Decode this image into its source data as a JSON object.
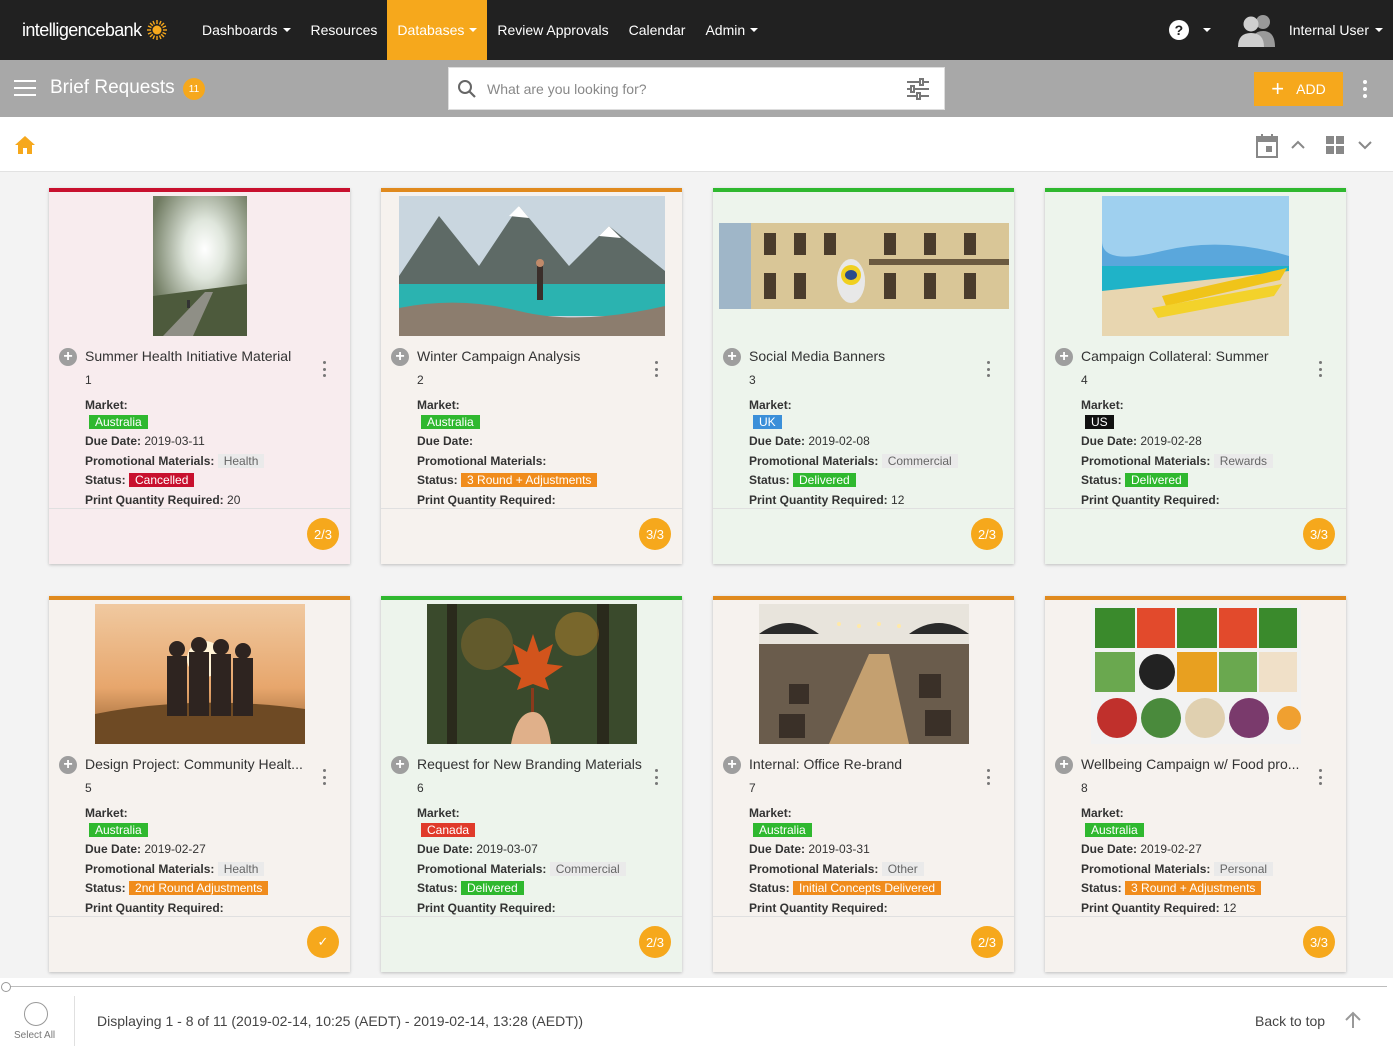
{
  "nav": {
    "logo": "intelligencebank",
    "items": [
      {
        "label": "Dashboards",
        "caret": true,
        "active": false
      },
      {
        "label": "Resources",
        "caret": false,
        "active": false
      },
      {
        "label": "Databases",
        "caret": true,
        "active": true
      },
      {
        "label": "Review Approvals",
        "caret": false,
        "active": false
      },
      {
        "label": "Calendar",
        "caret": false,
        "active": false
      },
      {
        "label": "Admin",
        "caret": true,
        "active": false
      }
    ],
    "help": "?",
    "user": "Internal User"
  },
  "toolbar": {
    "title": "Brief Requests",
    "count": "11",
    "search_placeholder": "What are you looking for?",
    "add_label": "ADD"
  },
  "cards": [
    {
      "title": "Summer Health Initiative Material",
      "id": "1",
      "bg": "#f8ecee",
      "bar": "#c8102e",
      "image": "sun-road",
      "market": "Australia",
      "market_color": "#2fb82f",
      "due": "2019-03-11",
      "promo": "Health",
      "status": "Cancelled",
      "status_color": "#c8102e",
      "print_qty": "20",
      "progress": "2/3"
    },
    {
      "title": "Winter Campaign Analysis",
      "id": "2",
      "bg": "#f6f2ee",
      "bar": "#e08a1e",
      "image": "lake",
      "market": "Australia",
      "market_color": "#2fb82f",
      "due": "",
      "promo": "",
      "status": "3 Round + Adjustments",
      "status_color": "#f08c1c",
      "print_qty": "",
      "progress": "3/3"
    },
    {
      "title": "Social Media Banners",
      "id": "3",
      "bg": "#edf4ec",
      "bar": "#2fb82f",
      "image": "building",
      "market": "UK",
      "market_color": "#3b8fd9",
      "due": "2019-02-08",
      "promo": "Commercial",
      "status": "Delivered",
      "status_color": "#2fb82f",
      "print_qty": "12",
      "progress": "2/3"
    },
    {
      "title": "Campaign Collateral: Summer",
      "id": "4",
      "bg": "#edf4ec",
      "bar": "#2fb82f",
      "image": "kayak",
      "market": "US",
      "market_color": "#111111",
      "due": "2019-02-28",
      "promo": "Rewards",
      "status": "Delivered",
      "status_color": "#2fb82f",
      "print_qty": "",
      "progress": "3/3"
    },
    {
      "title": "Design Project: Community Healt...",
      "id": "5",
      "bg": "#f6f2ee",
      "bar": "#e08a1e",
      "image": "friends",
      "market": "Australia",
      "market_color": "#2fb82f",
      "due": "2019-02-27",
      "promo": "Health",
      "status": "2nd Round Adjustments",
      "status_color": "#f08c1c",
      "print_qty": "",
      "progress": "✓"
    },
    {
      "title": "Request for New Branding Materials",
      "id": "6",
      "bg": "#edf4ec",
      "bar": "#2fb82f",
      "image": "leaf",
      "market": "Canada",
      "market_color": "#e03a2a",
      "due": "2019-03-07",
      "promo": "Commercial",
      "status": "Delivered",
      "status_color": "#2fb82f",
      "print_qty": "",
      "progress": "2/3"
    },
    {
      "title": "Internal: Office Re-brand",
      "id": "7",
      "bg": "#f6f2ee",
      "bar": "#e08a1e",
      "image": "office",
      "market": "Australia",
      "market_color": "#2fb82f",
      "due": "2019-03-31",
      "promo": "Other",
      "status": "Initial Concepts Delivered",
      "status_color": "#f08c1c",
      "print_qty": "",
      "progress": "2/3"
    },
    {
      "title": "Wellbeing Campaign w/ Food pro...",
      "id": "8",
      "bg": "#f6f2ee",
      "bar": "#e08a1e",
      "image": "food",
      "market": "Australia",
      "market_color": "#2fb82f",
      "due": "2019-02-27",
      "promo": "Personal",
      "status": "3 Round + Adjustments",
      "status_color": "#f08c1c",
      "print_qty": "12",
      "progress": "3/3"
    }
  ],
  "labels": {
    "market": "Market:",
    "due": "Due Date:",
    "promo": "Promotional Materials:",
    "status": "Status:",
    "print_qty": "Print Quantity Required:"
  },
  "footer": {
    "select_all": "Select All",
    "displaying": "Displaying 1 - 8 of 11 (2019-02-14, 10:25 (AEDT) - 2019-02-14, 13:28 (AEDT))",
    "back_to_top": "Back to top"
  }
}
